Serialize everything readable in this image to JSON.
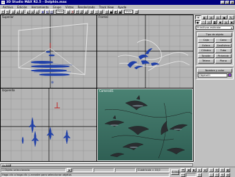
{
  "window": {
    "title": "3D Studio MAX R2.5 - Dolphin.max"
  },
  "menubar": {
    "items": [
      "Archivo",
      "Edición",
      "Herramienta",
      "Grupo",
      "Vistas",
      "Renderizado",
      "Track View",
      "Ayuda"
    ]
  },
  "toolbar": {
    "view_dropdown": "Vista",
    "select_dropdown": "Vista"
  },
  "viewports": {
    "top_label": "Superior",
    "front_label": "Frontal",
    "left_label": "Izquierda",
    "camera_label": "Camera01"
  },
  "command_panel": {
    "category_dropdown": "Primitivas estándar",
    "rollout_object_type": "Tipo de objeto",
    "buttons": [
      "Caja",
      "Cono",
      "Esfera",
      "GeoEsfera",
      "Cilindro",
      "Tubo",
      "Toroide",
      "Pirámide",
      "Tetera",
      "Plano"
    ],
    "rollout_name_color": "Nombre y color",
    "object_name": "Objeto01"
  },
  "timeslider": {
    "frame_label": "0 / 100"
  },
  "statusbar": {
    "selection_status": "1 Objeto seleccionado",
    "prompt": "Haga clic o haga clic y arrastre para seleccionar objetos",
    "grid_status": "Cuadrícula = 10,0",
    "animate_label": "Animar"
  },
  "colors": {
    "titlebar": "#000080",
    "window_bg": "#c0c0c0",
    "viewport_bg": "#b4b4b4",
    "camera_viewport_bg": "#3b6f62",
    "wire_object": "#1f3fa8"
  }
}
